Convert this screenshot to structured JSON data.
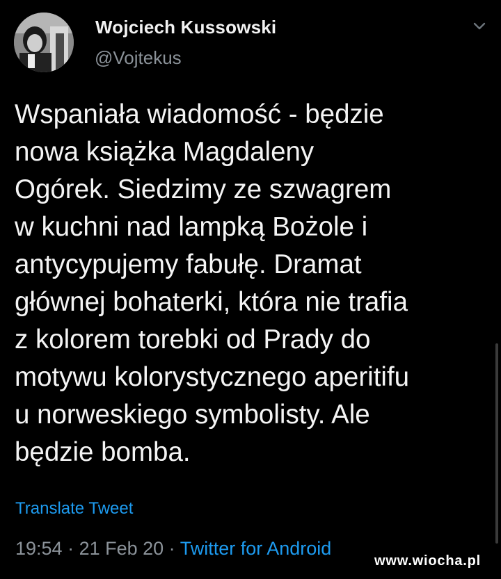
{
  "author": {
    "name": "Wojciech Kussowski",
    "handle": "@Vojtekus"
  },
  "tweet": {
    "lines": [
      "Wspaniała wiadomość - będzie",
      "nowa książka Magdaleny",
      "Ogórek. Siedzimy ze szwagrem",
      "w kuchni nad lampką Bożole i",
      "antycypujemy fabułę. Dramat",
      "głównej bohaterki, która nie trafia",
      "z kolorem torebki od Prady do",
      "motywu kolorystycznego aperitifu",
      "u norweskiego symbolisty. Ale",
      "będzie bomba."
    ],
    "translate_label": "Translate Tweet"
  },
  "meta": {
    "time": "19:54",
    "separator": " · ",
    "date": "21 Feb 20",
    "source": "Twitter for Android"
  },
  "watermark": "www.wiocha.pl",
  "icons": {
    "more": "chevron-down-icon",
    "avatar": "avatar"
  },
  "colors": {
    "background": "#000000",
    "text": "#f4f4f4",
    "secondary": "#8b9299",
    "link": "#1d9bf0"
  }
}
